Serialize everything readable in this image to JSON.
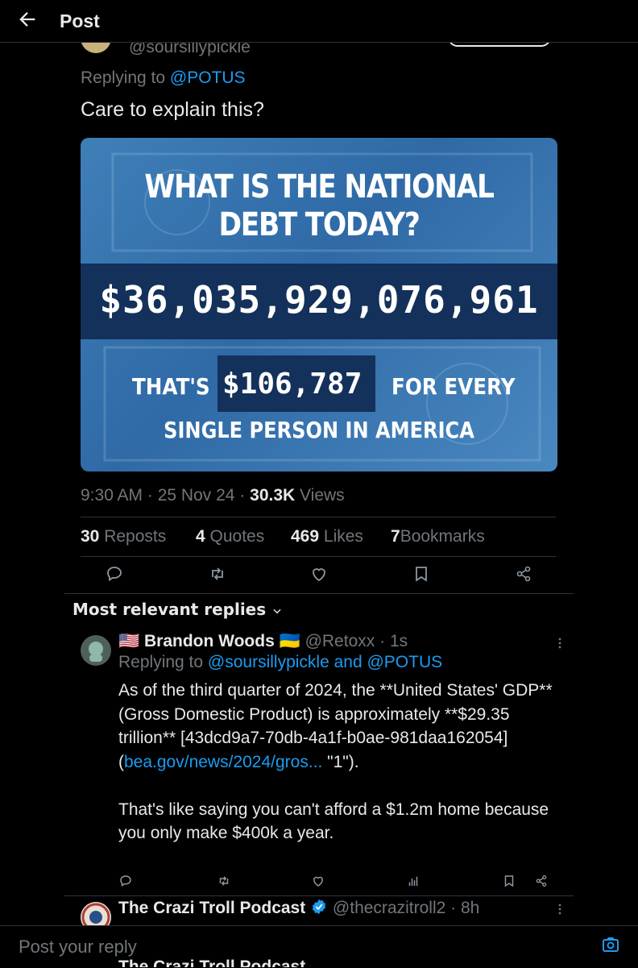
{
  "header": {
    "title": "Post"
  },
  "tweet": {
    "handle": "@soursillypickle",
    "replying_prefix": "Replying to ",
    "replying_to": "@POTUS",
    "text": "Care to explain this?",
    "image": {
      "title_line1": "WHAT IS THE NATIONAL",
      "title_line2": "DEBT TODAY?",
      "amount": "$36,035,929,076,961",
      "thats": "THAT'S",
      "per_person": "$106,787",
      "for_every": "FOR EVERY",
      "line2": "SINGLE PERSON IN AMERICA"
    },
    "time": "9:30 AM",
    "date": "25 Nov 24",
    "views_count": "30.3K",
    "views_label": "Views",
    "stats": {
      "reposts_n": "30",
      "reposts_label": "Reposts",
      "quotes_n": "4",
      "quotes_label": "Quotes",
      "likes_n": "469",
      "likes_label": "Likes",
      "bookmarks_n": "7",
      "bookmarks_label": "Bookmarks"
    }
  },
  "replies_header": "Most relevant replies",
  "reply1": {
    "name": "🇺🇸 Brandon Woods 🇺🇦",
    "handle": "@Retoxx",
    "time": "1s",
    "replying_prefix": "Replying to ",
    "replying_to": "@soursillypickle and @POTUS",
    "body_part1": "As of the third quarter of 2024, the **United States' GDP** (Gross Domestic Product) is approximately **$29.35  trillion** [43dcd9a7-70db-4a1f-b0ae-981daa162054] (",
    "body_link": "bea.gov/news/2024/gros...",
    "body_part2": " \"1\").\n\nThat's like saying you can't afford a $1.2m home because you only make $400k a year."
  },
  "reply2": {
    "name": "The Crazi Troll Podcast",
    "handle": "@thecrazitroll2",
    "time": "8h",
    "ghost_text": "The Crazi Troll Podcast"
  },
  "compose": {
    "placeholder": "Post your reply"
  }
}
